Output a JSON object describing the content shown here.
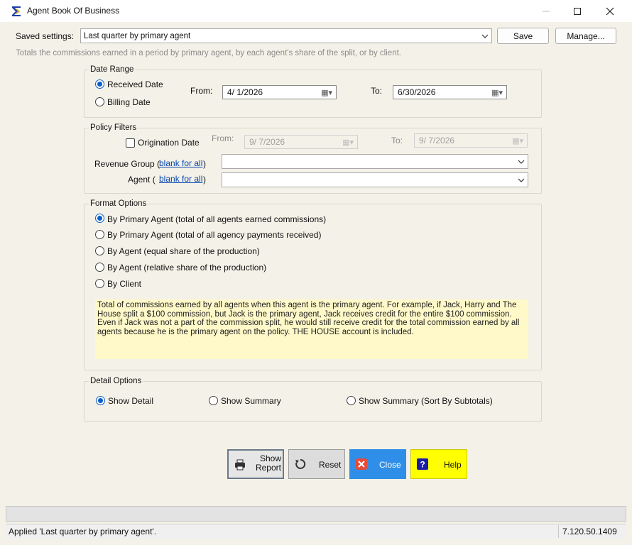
{
  "window": {
    "title": "Agent Book Of Business"
  },
  "saved_settings": {
    "label": "Saved settings:",
    "value": "Last quarter by primary agent",
    "save_label": "Save",
    "manage_label": "Manage..."
  },
  "description": "Totals the commissions earned in a period by primary agent, by each agent's share of the split, or by client.",
  "date_range": {
    "title": "Date Range",
    "received_label": "Received Date",
    "billing_label": "Billing Date",
    "from_label": "From:",
    "from_value": "4/  1/2026",
    "to_label": "To:",
    "to_value": "6/30/2026"
  },
  "policy_filters": {
    "title": "Policy Filters",
    "origination_label": "Origination Date",
    "from_label": "From:",
    "from_value": "9/  7/2026",
    "to_label": "To:",
    "to_value": "9/  7/2026",
    "revenue_group_label": "Revenue Group (",
    "agent_label": "Agent (",
    "blank_link": "blank for all",
    "close_paren": ")"
  },
  "format_options": {
    "title": "Format Options",
    "options": [
      "By Primary Agent (total of all agents earned commissions)",
      "By Primary Agent (total of all agency payments received)",
      "By Agent (equal share of the production)",
      "By Agent (relative share of the production)",
      "By Client"
    ],
    "info": "Total of commissions earned by all agents when this agent is the primary agent. For example, if Jack, Harry and The House split a $100 commission, but Jack is the primary agent, Jack receives credit for the entire $100 commission. Even if Jack was not a part of the commission split, he would still receive credit for the total commission earned by all agents because he is the primary agent on the policy. THE HOUSE account is included."
  },
  "detail_options": {
    "title": "Detail Options",
    "show_detail": "Show Detail",
    "show_summary": "Show Summary",
    "show_summary_sorted": "Show Summary (Sort By Subtotals)"
  },
  "buttons": {
    "show_report_line1": "Show",
    "show_report_line2": "Report",
    "reset": "Reset",
    "close": "Close",
    "help": "Help"
  },
  "colors": {
    "close_bg": "#2f8fe8",
    "help_bg": "#ffff00",
    "info_bg": "#fff8c8",
    "accent": "#0a5fc7"
  },
  "status": {
    "message": "Applied 'Last quarter by primary agent'.",
    "version": "7.120.50.1409"
  }
}
